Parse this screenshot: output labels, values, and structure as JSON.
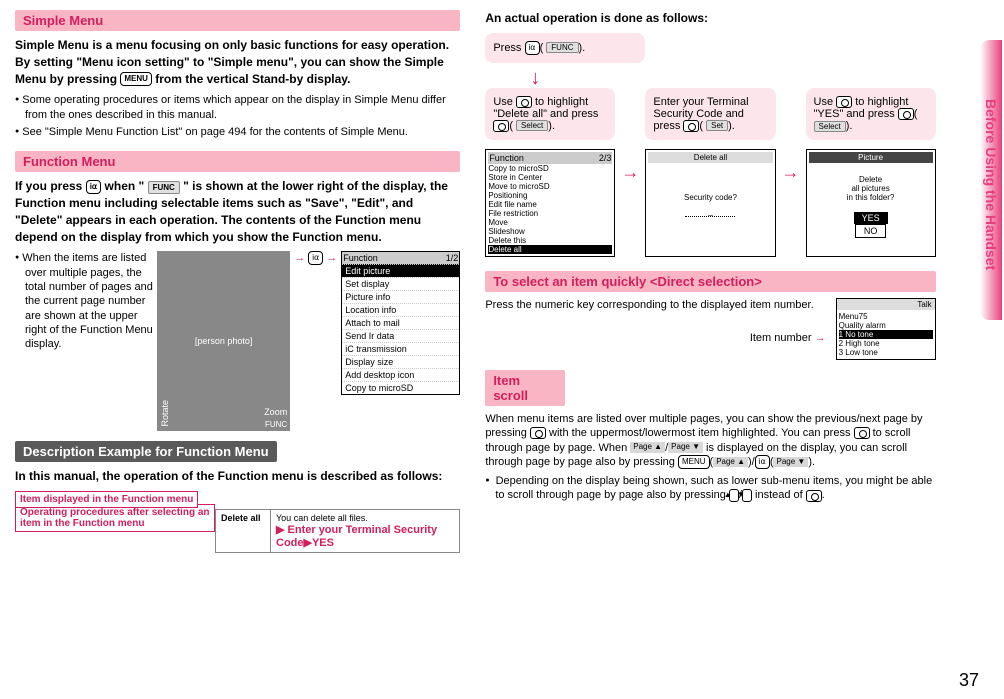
{
  "sideTab": "Before Using the Handset",
  "pageNum": "37",
  "simpleMenu": {
    "header": "Simple Menu",
    "intro": "Simple Menu is a menu focusing on only basic functions for easy operation. By setting \"Menu icon setting\" to \"Simple menu\", you can show the Simple Menu by pressing ",
    "intro2": " from the vertical Stand-by display.",
    "bullet1": "Some operating procedures or items which appear on the display in Simple Menu differ from the ones described in this manual.",
    "bullet2": "See \"Simple Menu Function List\" on page 494 for the contents of Simple Menu.",
    "menuBtn": "MENU"
  },
  "functionMenu": {
    "header": "Function Menu",
    "intro1": "If you press ",
    "btn1": "i⍺",
    "intro2": " when \"",
    "funcLabel": "FUNC",
    "intro3": "\" is shown at the lower right of the display, the Function menu including selectable items such as \"Save\", \"Edit\", and \"Delete\" appears in each operation. The contents of the Function menu depend on the display from which you show the Function menu.",
    "bullet1": "When the items are listed over multiple pages, the total number of pages and the current page number are shown at the upper right of the Function Menu display.",
    "rotateLabel": "Rotate",
    "zoomLabel": "Zoom",
    "funcBottomLabel": "FUNC",
    "funcPanel": {
      "title": "Function",
      "page": "1/2",
      "items": [
        "Edit picture",
        "Set display",
        "Picture info",
        "Location info",
        "Attach to mail",
        "Send Ir data",
        "iC transmission",
        "Display size",
        "Add desktop icon",
        "Copy to microSD"
      ]
    }
  },
  "descExample": {
    "header": "Description Example for Function Menu",
    "intro": "In this manual, the operation of the Function menu is described as follows:",
    "label1": "Item displayed in the Function menu",
    "label2": "Operating procedures after selecting an item in the Function menu",
    "col1": "Delete all",
    "col2a": "You can delete all files.",
    "col2b": "▶ Enter your Terminal Security Code▶YES"
  },
  "actualOp": {
    "header": "An actual operation is done as follows:",
    "press": "Press ",
    "funcBtnLabel": "FUNC",
    "step1a": "Use ",
    "step1b": " to highlight \"Delete all\" and press ",
    "selectLabel": "Select",
    "step2a": "Enter your Terminal Security Code and press ",
    "setLabel": "Set",
    "step3a": "Use ",
    "step3b": " to highlight \"YES\" and press ",
    "panel1": {
      "title": "Function",
      "page": "2/3",
      "items": [
        "Copy to microSD",
        "Store in Center",
        "Move to microSD",
        "Positioning",
        "Edit file name",
        "File restriction",
        "Move",
        "Slideshow",
        "Delete this",
        "Delete all"
      ]
    },
    "panel2": {
      "title": "Delete all",
      "msg": "Security code?",
      "input": "_"
    },
    "panel3": {
      "title": "Picture",
      "msg": "Delete\nall pictures\nin this folder?",
      "yes": "YES",
      "no": "NO"
    }
  },
  "directSelection": {
    "header": "To select an item quickly <Direct selection>",
    "text": "Press the numeric key corresponding to the displayed item number.",
    "itemNumLabel": "Item number",
    "panel": {
      "title": "Talk",
      "menuLabel": "Menu75",
      "quality": "Quality alarm",
      "items": [
        "No tone",
        "High tone",
        "Low tone"
      ]
    }
  },
  "itemScroll": {
    "header": "Item scroll",
    "text1": "When menu items are listed over multiple pages, you can show the previous/next page by pressing ",
    "text2": " with the uppermost/lowermost item highlighted. You can press ",
    "text3": " to scroll through page by page. When ",
    "pageUp": "Page ▲",
    "pageDown": "Page ▼",
    "text4": " is displayed on the display, you can scroll through page by page also by pressing ",
    "menuBtn": "MENU",
    "iaBtn": "i⍺",
    "bullet1": "Depending on the display being shown, such as lower sub-menu items, you might be able to scroll through page by page also by pressing ",
    "text5": " instead of ",
    "up": "▲",
    "down": "▼"
  }
}
